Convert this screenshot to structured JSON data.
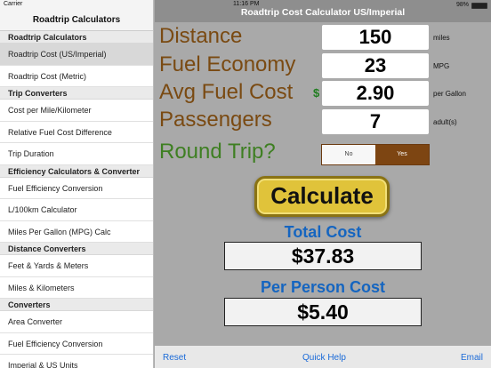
{
  "status": {
    "carrier": "Carrier",
    "time": "11:16 PM",
    "battery": "98%",
    "battery_level": 0.98
  },
  "sidebar": {
    "title": "Roadtrip Calculators",
    "groups": [
      {
        "section": "Roadtrip Calculators",
        "items": [
          "Roadtrip Cost (US/Imperial)",
          "Roadtrip Cost (Metric)"
        ]
      },
      {
        "section": "Trip Converters",
        "items": [
          "Cost per Mile/Kilometer",
          "Relative Fuel Cost Difference",
          "Trip Duration"
        ]
      },
      {
        "section": "Efficiency Calculators & Converter",
        "items": [
          "Fuel Efficiency Conversion",
          "L/100km Calculator",
          "Miles Per Gallon (MPG) Calc"
        ]
      },
      {
        "section": "Distance Converters",
        "items": [
          "Feet & Yards & Meters",
          "Miles & Kilometers"
        ]
      },
      {
        "section": "Converters",
        "items": [
          "Area Converter",
          "Fuel Efficiency Conversion",
          "Imperial & US Units"
        ]
      }
    ],
    "selected": "Roadtrip Cost (US/Imperial)"
  },
  "main": {
    "title": "Roadtrip Cost Calculator US/Imperial",
    "fields": {
      "distance": {
        "label": "Distance",
        "value": "150",
        "unit": "miles"
      },
      "fuel_economy": {
        "label": "Fuel Economy",
        "value": "23",
        "unit": "MPG"
      },
      "fuel_cost": {
        "label": "Avg Fuel Cost",
        "currency": "$",
        "value": "2.90",
        "unit": "per Gallon"
      },
      "passengers": {
        "label": "Passengers",
        "value": "7",
        "unit": "adult(s)"
      }
    },
    "round_trip": {
      "label": "Round Trip?",
      "no": "No",
      "yes": "Yes",
      "selected": "Yes"
    },
    "calculate_label": "Calculate",
    "total": {
      "label": "Total Cost",
      "value": "$37.83"
    },
    "per_person": {
      "label": "Per Person Cost",
      "value": "$5.40"
    }
  },
  "bottom": {
    "reset": "Reset",
    "quick_help": "Quick Help",
    "email": "Email"
  },
  "colors": {
    "label_brown": "#7a4a12",
    "label_green": "#3e7f22",
    "result_blue": "#1565c0",
    "button_gold": "#e0c33a",
    "accent_brown": "#7d4512"
  }
}
